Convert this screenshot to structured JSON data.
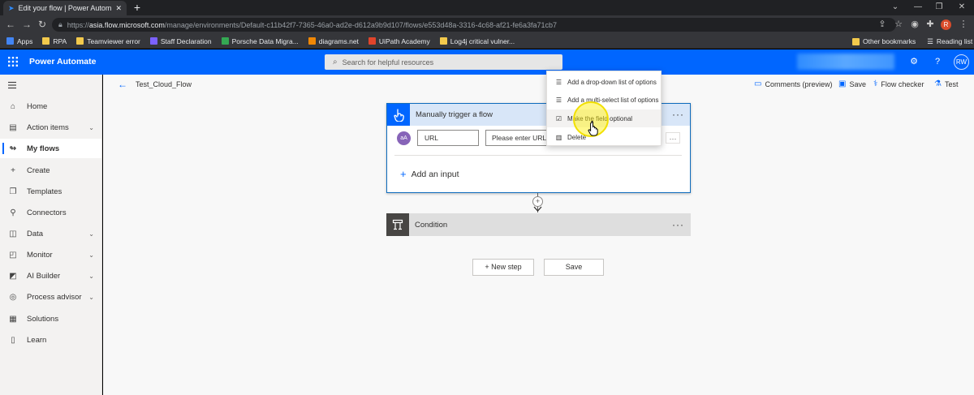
{
  "browser": {
    "tab_title": "Edit your flow | Power Automate",
    "url_host": "asia.flow.microsoft.com",
    "url_scheme": "https://",
    "url_path": "/manage/environments/Default-c11b42f7-7365-46a0-ad2e-d612a9b9d107/flows/e553d48a-3316-4c68-af21-fe6a3fa71cb7",
    "profile_initial": "R",
    "bookmarks": [
      {
        "label": "Apps",
        "color": "#4285f4"
      },
      {
        "label": "RPA",
        "color": "#f2c94c"
      },
      {
        "label": "Teamviewer error",
        "color": "#f2c94c"
      },
      {
        "label": "Staff Declaration",
        "color": "#7b61ff"
      },
      {
        "label": "Porsche Data Migra...",
        "color": "#34a853"
      },
      {
        "label": "diagrams.net",
        "color": "#f08705"
      },
      {
        "label": "UiPath Academy",
        "color": "#e0442b"
      },
      {
        "label": "Log4j critical vulner...",
        "color": "#f2c94c"
      }
    ],
    "other_bookmarks": "Other bookmarks",
    "reading_list": "Reading list"
  },
  "header": {
    "app_name": "Power Automate",
    "search_placeholder": "Search for helpful resources",
    "avatar_initials": "RW"
  },
  "nav": {
    "items": [
      {
        "label": "Home",
        "icon": "home-icon",
        "glyph": "⌂"
      },
      {
        "label": "Action items",
        "icon": "clipboard-icon",
        "glyph": "▤",
        "chevron": true
      },
      {
        "label": "My flows",
        "icon": "flow-icon",
        "glyph": "↬",
        "active": true
      },
      {
        "label": "Create",
        "icon": "plus-icon",
        "glyph": "+"
      },
      {
        "label": "Templates",
        "icon": "templates-icon",
        "glyph": "❐"
      },
      {
        "label": "Connectors",
        "icon": "connector-icon",
        "glyph": "⚲"
      },
      {
        "label": "Data",
        "icon": "database-icon",
        "glyph": "◫",
        "chevron": true
      },
      {
        "label": "Monitor",
        "icon": "monitor-icon",
        "glyph": "◰",
        "chevron": true
      },
      {
        "label": "AI Builder",
        "icon": "ai-builder-icon",
        "glyph": "◩",
        "chevron": true
      },
      {
        "label": "Process advisor",
        "icon": "process-advisor-icon",
        "glyph": "◎",
        "chevron": true
      },
      {
        "label": "Solutions",
        "icon": "solutions-icon",
        "glyph": "▦"
      },
      {
        "label": "Learn",
        "icon": "book-icon",
        "glyph": "▯"
      }
    ]
  },
  "editor": {
    "flow_name": "Test_Cloud_Flow",
    "commands": {
      "comments": "Comments (preview)",
      "save": "Save",
      "flow_checker": "Flow checker",
      "test": "Test"
    },
    "trigger": {
      "title": "Manually trigger a flow",
      "input_icon_text": "aA",
      "input_name": "URL",
      "input_placeholder": "Please enter URL",
      "add_input": "Add an input"
    },
    "condition": {
      "title": "Condition"
    },
    "buttons": {
      "new_step": "+ New step",
      "save": "Save"
    },
    "context_menu": [
      {
        "label": "Add a drop-down list of options",
        "icon": "list-icon",
        "glyph": "☰"
      },
      {
        "label": "Add a multi-select list of options",
        "icon": "multi-list-icon",
        "glyph": "☰"
      },
      {
        "label": "Make the field optional",
        "icon": "checkbox-icon",
        "glyph": "☑"
      },
      {
        "label": "Delete",
        "icon": "trash-icon",
        "glyph": "🗑"
      }
    ]
  },
  "colors": {
    "brand_blue": "#0066ff",
    "highlight_yellow": "#f2e000"
  }
}
